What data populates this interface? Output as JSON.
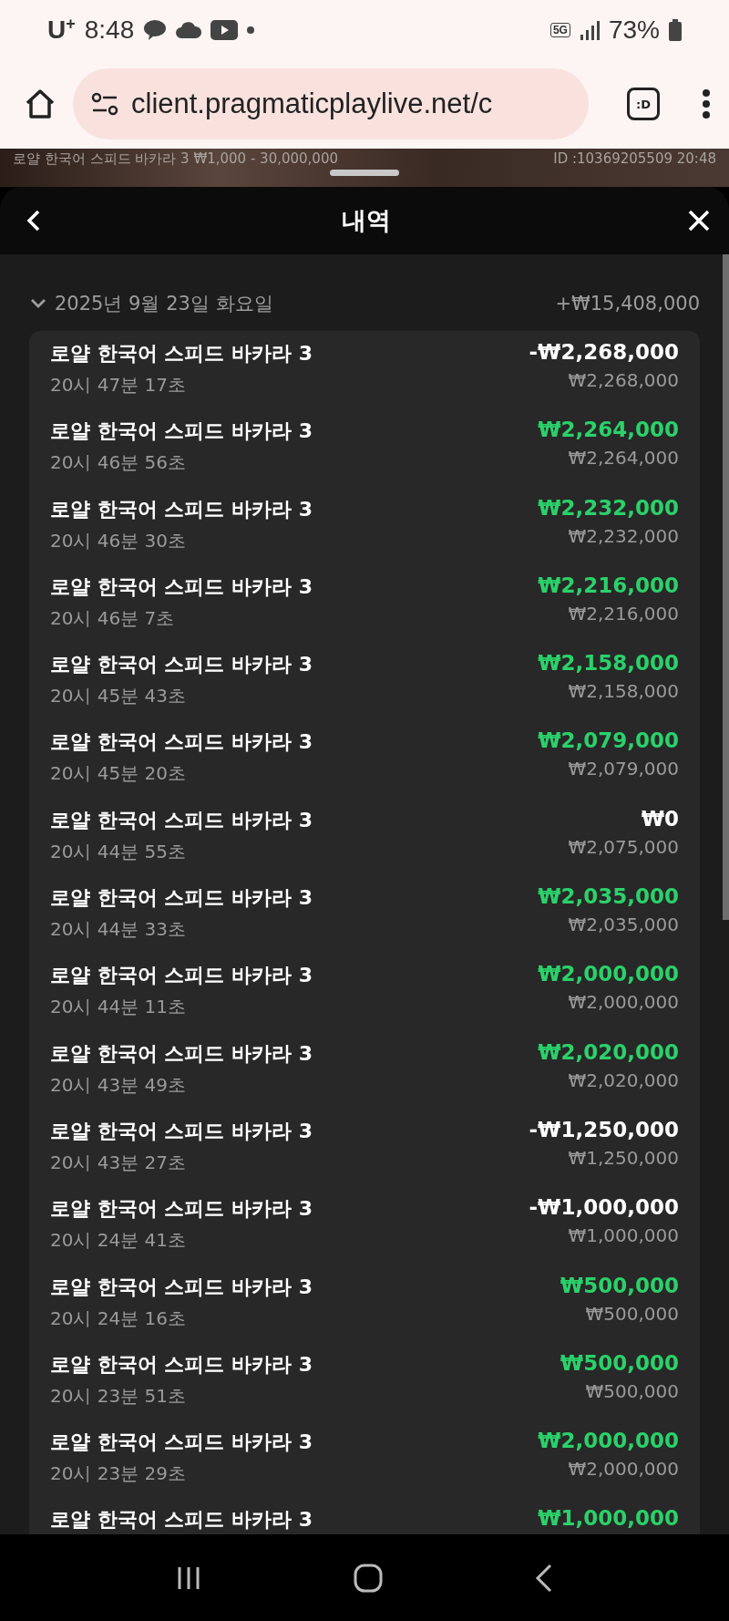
{
  "status_bar": {
    "carrier": "U",
    "carrier_mark": "+",
    "time": "8:48",
    "network": "5G",
    "battery": "73%"
  },
  "browser": {
    "url": "client.pragmaticplaylive.net/c",
    "tab_button": ":D"
  },
  "game_strip": {
    "table": "로얄 한국어 스피드 바카라 3 ₩1,000 - 30,000,000",
    "session": "ID :10369205509 20:48"
  },
  "sheet": {
    "title": "내역"
  },
  "day": {
    "date": "2025년 9월 23일 화요일",
    "total": "+₩15,408,000",
    "expanded": true
  },
  "rows": [
    {
      "game": "로얄 한국어 스피드 바카라 3",
      "time": "20시 47분 17초",
      "result": "-₩2,268,000",
      "kind": "loss",
      "stake": "₩2,268,000"
    },
    {
      "game": "로얄 한국어 스피드 바카라 3",
      "time": "20시 46분 56초",
      "result": "₩2,264,000",
      "kind": "win",
      "stake": "₩2,264,000"
    },
    {
      "game": "로얄 한국어 스피드 바카라 3",
      "time": "20시 46분 30초",
      "result": "₩2,232,000",
      "kind": "win",
      "stake": "₩2,232,000"
    },
    {
      "game": "로얄 한국어 스피드 바카라 3",
      "time": "20시 46분 7초",
      "result": "₩2,216,000",
      "kind": "win",
      "stake": "₩2,216,000"
    },
    {
      "game": "로얄 한국어 스피드 바카라 3",
      "time": "20시 45분 43초",
      "result": "₩2,158,000",
      "kind": "win",
      "stake": "₩2,158,000"
    },
    {
      "game": "로얄 한국어 스피드 바카라 3",
      "time": "20시 45분 20초",
      "result": "₩2,079,000",
      "kind": "win",
      "stake": "₩2,079,000"
    },
    {
      "game": "로얄 한국어 스피드 바카라 3",
      "time": "20시 44분 55초",
      "result": "₩0",
      "kind": "zero",
      "stake": "₩2,075,000"
    },
    {
      "game": "로얄 한국어 스피드 바카라 3",
      "time": "20시 44분 33초",
      "result": "₩2,035,000",
      "kind": "win",
      "stake": "₩2,035,000"
    },
    {
      "game": "로얄 한국어 스피드 바카라 3",
      "time": "20시 44분 11초",
      "result": "₩2,000,000",
      "kind": "win",
      "stake": "₩2,000,000"
    },
    {
      "game": "로얄 한국어 스피드 바카라 3",
      "time": "20시 43분 49초",
      "result": "₩2,020,000",
      "kind": "win",
      "stake": "₩2,020,000"
    },
    {
      "game": "로얄 한국어 스피드 바카라 3",
      "time": "20시 43분 27초",
      "result": "-₩1,250,000",
      "kind": "loss",
      "stake": "₩1,250,000"
    },
    {
      "game": "로얄 한국어 스피드 바카라 3",
      "time": "20시 24분 41초",
      "result": "-₩1,000,000",
      "kind": "loss",
      "stake": "₩1,000,000"
    },
    {
      "game": "로얄 한국어 스피드 바카라 3",
      "time": "20시 24분 16초",
      "result": "₩500,000",
      "kind": "win",
      "stake": "₩500,000"
    },
    {
      "game": "로얄 한국어 스피드 바카라 3",
      "time": "20시 23분 51초",
      "result": "₩500,000",
      "kind": "win",
      "stake": "₩500,000"
    },
    {
      "game": "로얄 한국어 스피드 바카라 3",
      "time": "20시 23분 29초",
      "result": "₩2,000,000",
      "kind": "win",
      "stake": "₩2,000,000"
    },
    {
      "game": "로얄 한국어 스피드 바카라 3",
      "result": "₩1,000,000",
      "kind": "win"
    }
  ]
}
